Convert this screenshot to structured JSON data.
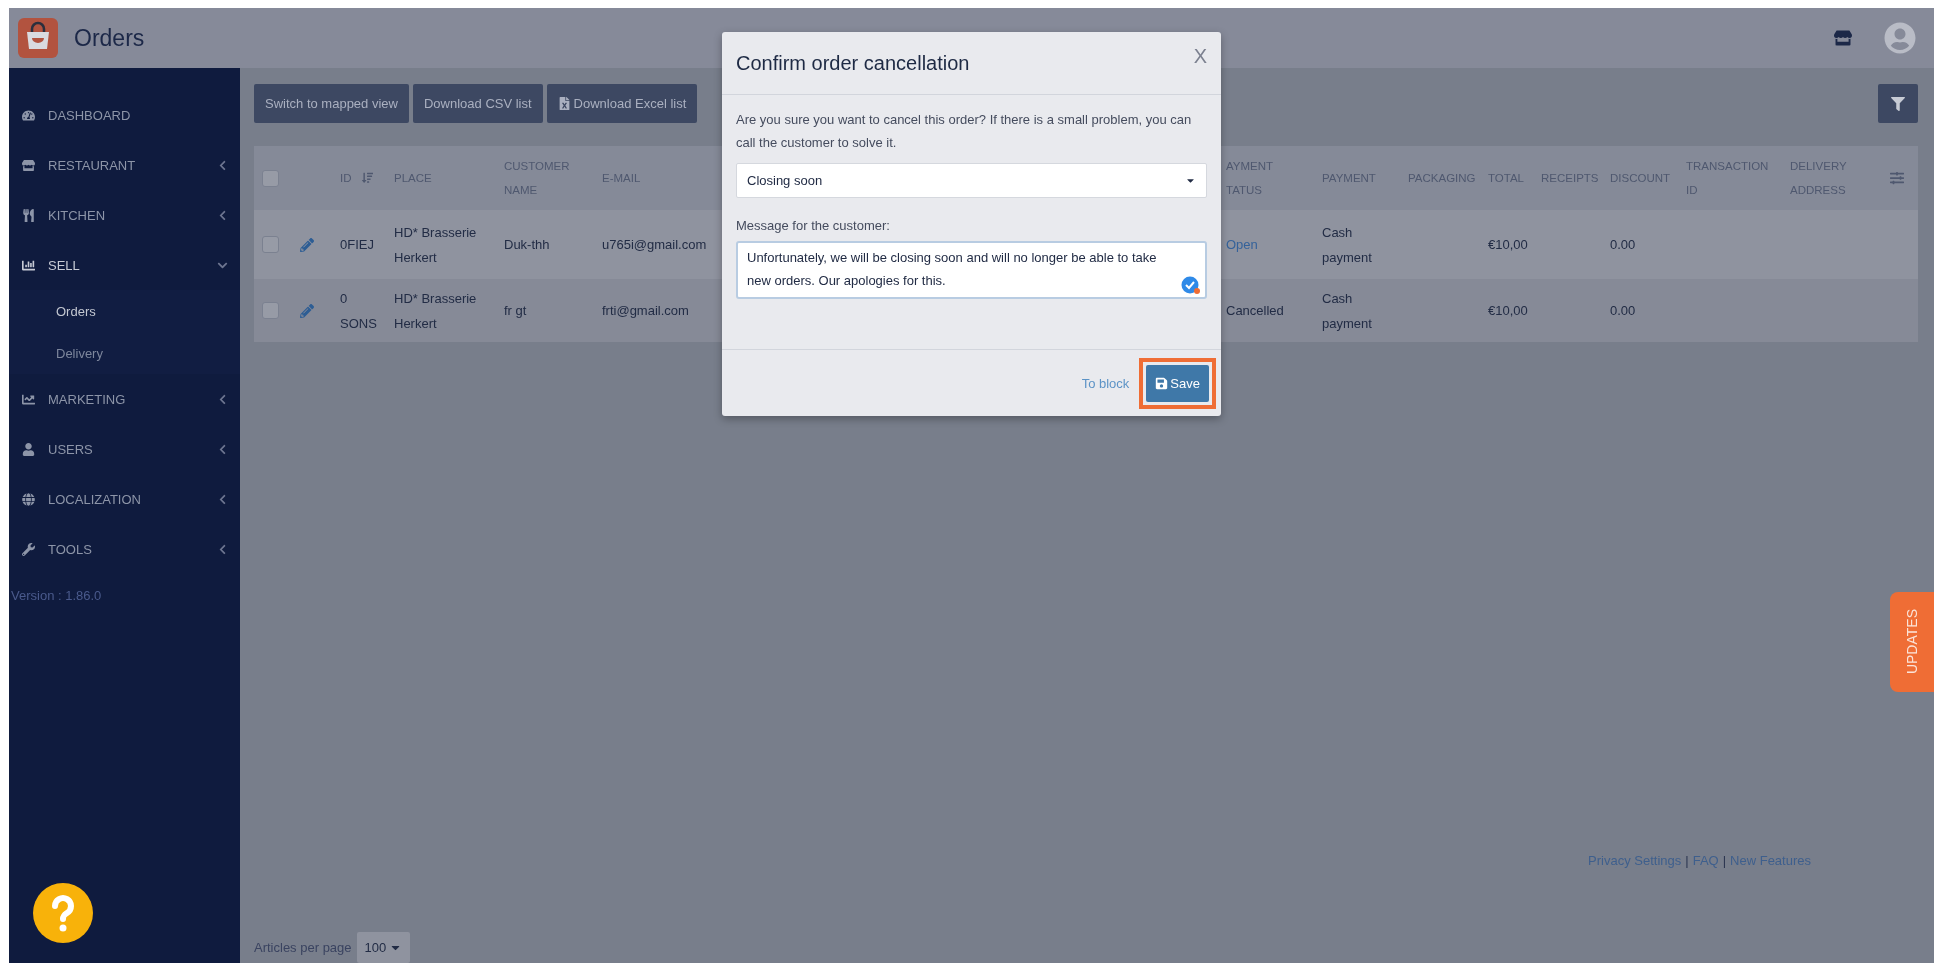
{
  "header": {
    "title": "Orders"
  },
  "sidebar": {
    "items": [
      {
        "label": "DASHBOARD",
        "kind": "link"
      },
      {
        "label": "RESTAURANT",
        "kind": "group",
        "expanded": false
      },
      {
        "label": "KITCHEN",
        "kind": "group",
        "expanded": false
      },
      {
        "label": "SELL",
        "kind": "group",
        "expanded": true,
        "children": [
          {
            "label": "Orders",
            "selected": true
          },
          {
            "label": "Delivery",
            "selected": false
          }
        ]
      },
      {
        "label": "MARKETING",
        "kind": "group",
        "expanded": false
      },
      {
        "label": "USERS",
        "kind": "group",
        "expanded": false
      },
      {
        "label": "LOCALIZATION",
        "kind": "group",
        "expanded": false
      },
      {
        "label": "TOOLS",
        "kind": "group",
        "expanded": false
      }
    ],
    "version": "Version : 1.86.0"
  },
  "toolbar": {
    "buttons": [
      {
        "label": "Switch to mapped view",
        "kind": "plain"
      },
      {
        "label": "Download CSV list",
        "kind": "plain"
      },
      {
        "label": "Download Excel list",
        "kind": "excel"
      }
    ]
  },
  "table": {
    "select_all": {
      "checked": false
    },
    "columns": [
      "ID",
      "PLACE",
      "CUSTOMER NAME",
      "E-MAIL",
      "AYMENT\nTATUS",
      "PAYMENT",
      "PACKAGING",
      "TOTAL",
      "RECEIPTS",
      "DISCOUNT",
      "TRANSACTION ID",
      "DELIVERY ADDRESS"
    ],
    "rows": [
      {
        "checked": false,
        "id": "0FIEJ",
        "place": "HD* Brasserie Herkert",
        "customer_name": "Duk-thh",
        "email": "u765i@gmail.com",
        "payment_status": {
          "text": "Open",
          "link": true
        },
        "payment": "Cash payment",
        "total": "€10,00",
        "discount": "0.00"
      },
      {
        "checked": false,
        "id": "0 SONS",
        "place": "HD* Brasserie Herkert",
        "customer_name": "fr gt",
        "email": "frti@gmail.com",
        "payment_status": {
          "text": "Cancelled",
          "link": false
        },
        "payment": "Cash payment",
        "total": "€10,00",
        "discount": "0.00"
      }
    ]
  },
  "footer_links": {
    "links": [
      "Privacy Settings",
      "FAQ",
      "New Features"
    ],
    "separator": "|"
  },
  "pagination": {
    "label": "Articles per page",
    "value": "100"
  },
  "updates_tab": "UPDATES",
  "modal": {
    "title": "Confirm order cancellation",
    "close": "X",
    "message": "Are you sure you want to cancel this order? If there is a small problem, you can call the customer to solve it.",
    "reason": {
      "value": "Closing soon"
    },
    "customer_message": {
      "label": "Message for the customer:",
      "value": "Unfortunately, we will be closing soon and will no longer be able to take new orders. Our apologies for this."
    },
    "secondary_action": "To block",
    "primary_action": "Save"
  }
}
